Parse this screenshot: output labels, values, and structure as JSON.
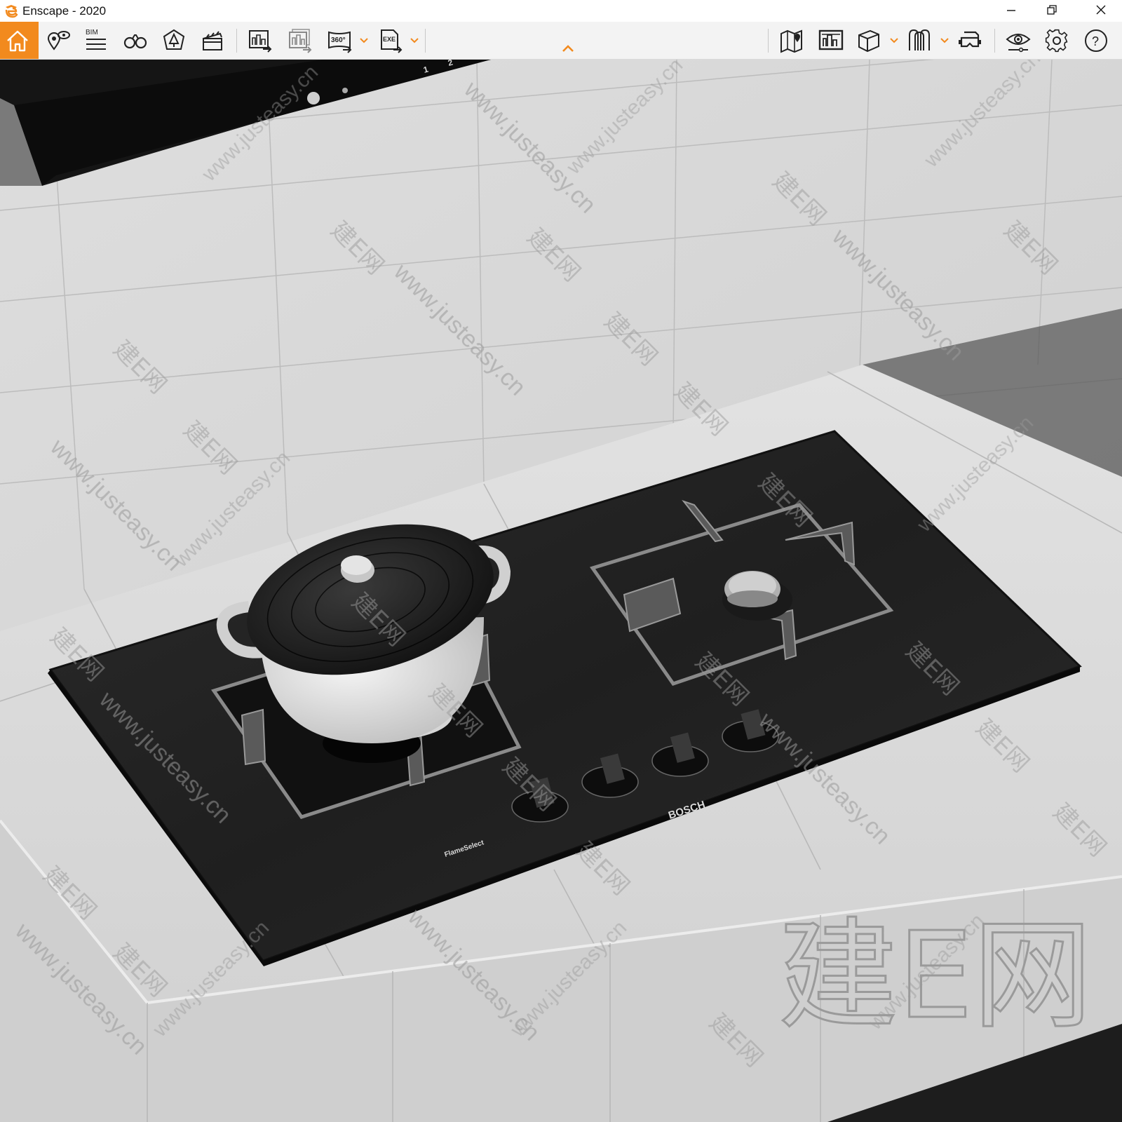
{
  "window": {
    "title": "Enscape - 2020",
    "buttons": [
      "minimize",
      "restore",
      "close"
    ],
    "accent_color": "#f28a1e"
  },
  "toolbar": {
    "items": [
      {
        "name": "home",
        "icon": "home-icon",
        "active": true
      },
      {
        "name": "views",
        "icon": "map-pin-eye-icon"
      },
      {
        "name": "bim",
        "icon": "bim-list-icon",
        "label": "BIM"
      },
      {
        "name": "binoculars",
        "icon": "binoculars-icon"
      },
      {
        "name": "asset-library",
        "icon": "tree-icon"
      },
      {
        "name": "video-editor",
        "icon": "clapperboard-icon"
      },
      {
        "name": "render-image",
        "icon": "render-image-icon"
      },
      {
        "name": "batch-render",
        "icon": "batch-render-icon"
      },
      {
        "name": "panorama",
        "icon": "panorama-360-icon",
        "label": "360°"
      },
      {
        "name": "export-exe",
        "icon": "exe-export-icon",
        "label": "EXE"
      },
      {
        "name": "collapse",
        "icon": "chevron-up-icon"
      },
      {
        "name": "map",
        "icon": "map-pin-icon"
      },
      {
        "name": "capture-manager",
        "icon": "gallery-icon"
      },
      {
        "name": "view-cube",
        "icon": "cube-icon"
      },
      {
        "name": "materials",
        "icon": "material-icon"
      },
      {
        "name": "vr-headset",
        "icon": "vr-headset-icon"
      },
      {
        "name": "visual-settings",
        "icon": "eye-settings-icon"
      },
      {
        "name": "general-settings",
        "icon": "gear-icon"
      },
      {
        "name": "help",
        "icon": "help-icon",
        "label": "?"
      }
    ]
  },
  "viewport": {
    "hood_labels": [
      "1",
      "2"
    ],
    "cooktop": {
      "brand": "BOSCH",
      "subbrand": "FlameSelect",
      "knob_count": 4
    },
    "watermarks": {
      "site": "www.justeasy.cn",
      "brand": "建E网"
    }
  }
}
